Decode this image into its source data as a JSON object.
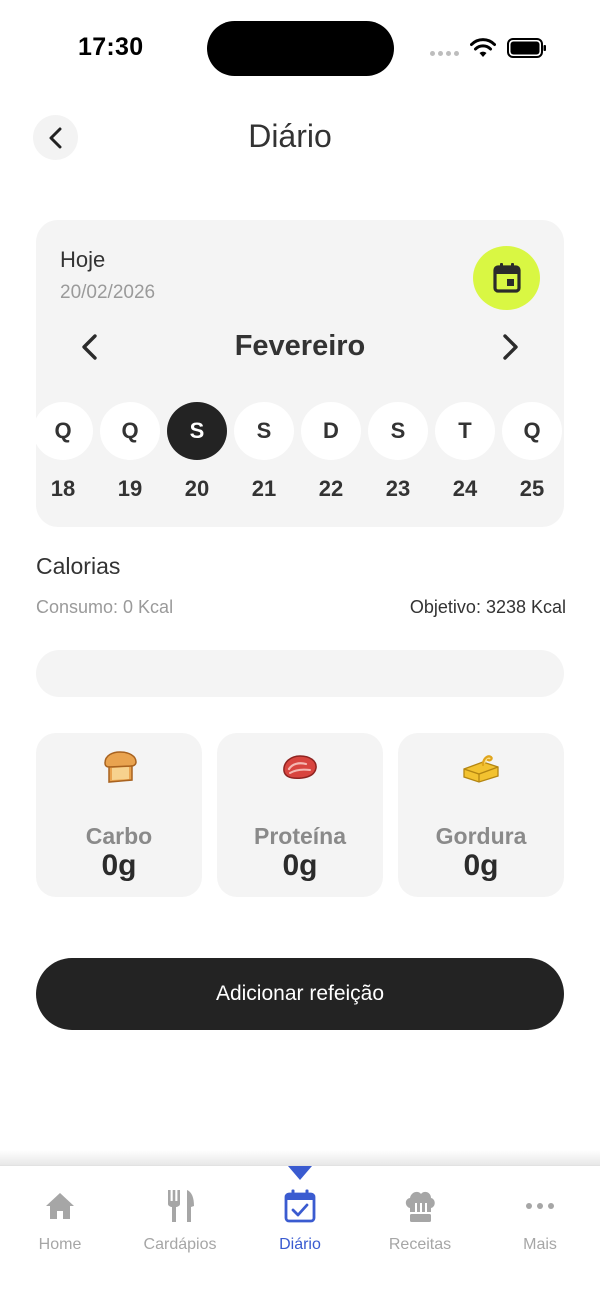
{
  "status": {
    "time": "17:30"
  },
  "header": {
    "title": "Diário"
  },
  "calendar": {
    "today_label": "Hoje",
    "today_date": "20/02/2026",
    "month": "Fevereiro",
    "days": [
      {
        "letter": "Q",
        "number": "18"
      },
      {
        "letter": "Q",
        "number": "19"
      },
      {
        "letter": "S",
        "number": "20",
        "selected": true
      },
      {
        "letter": "S",
        "number": "21"
      },
      {
        "letter": "D",
        "number": "22"
      },
      {
        "letter": "S",
        "number": "23"
      },
      {
        "letter": "T",
        "number": "24"
      },
      {
        "letter": "Q",
        "number": "25"
      }
    ],
    "accent_color": "#d9f743"
  },
  "calories": {
    "title": "Calorias",
    "consumption": "Consumo: 0 Kcal",
    "goal": "Objetivo: 3238 Kcal",
    "progress_fraction": 0
  },
  "macros": [
    {
      "name": "Carbo",
      "value": "0g",
      "icon": "bread-icon"
    },
    {
      "name": "Proteína",
      "value": "0g",
      "icon": "meat-icon"
    },
    {
      "name": "Gordura",
      "value": "0g",
      "icon": "butter-icon"
    }
  ],
  "actions": {
    "add_meal": "Adicionar refeição"
  },
  "tabbar": {
    "active_color": "#3a5bd0",
    "items": [
      {
        "label": "Home",
        "icon": "home-icon"
      },
      {
        "label": "Cardápios",
        "icon": "cutlery-icon"
      },
      {
        "label": "Diário",
        "icon": "calendar-check-icon",
        "active": true
      },
      {
        "label": "Receitas",
        "icon": "chef-hat-icon"
      },
      {
        "label": "Mais",
        "icon": "more-icon"
      }
    ]
  }
}
